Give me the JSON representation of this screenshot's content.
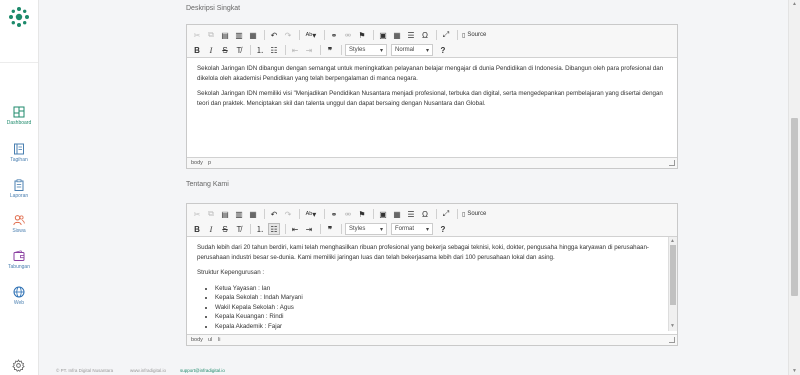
{
  "sidebar": {
    "items": [
      {
        "label": "Dashboard",
        "icon": "dashboard-icon"
      },
      {
        "label": "Tagihan",
        "icon": "book-icon"
      },
      {
        "label": "Laporan",
        "icon": "clipboard-icon"
      },
      {
        "label": "Siswa",
        "icon": "users-icon"
      },
      {
        "label": "Tabungan",
        "icon": "wallet-icon"
      },
      {
        "label": "Web",
        "icon": "globe-icon"
      }
    ],
    "accent": "#1d8a6b"
  },
  "section1": {
    "label": "Deskripsi Singkat",
    "toolbar": {
      "source_label": "Source",
      "styles_label": "Styles",
      "format_label": "Normal"
    },
    "paragraphs": [
      "Sekolah Jaringan IDN dibangun dengan semangat untuk meningkatkan pelayanan belajar mengajar di dunia Pendidikan di Indonesia. Dibangun oleh para profesional dan dikelola oleh akademisi Pendidikan yang telah berpengalaman di manca negara.",
      "Sekolah Jaringan IDN memiliki visi \"Menjadikan Pendidikan Nusantara menjadi profesional, terbuka dan digital, serta mengedepankan pembelajaran yang disertai dengan teori dan praktek. Menciptakan skil dan talenta unggul dan dapat bersaing dengan Nusantara dan Global."
    ],
    "path": [
      "body",
      "p"
    ]
  },
  "section2": {
    "label": "Tentang Kami",
    "toolbar": {
      "source_label": "Source",
      "styles_label": "Styles",
      "format_label": "Format"
    },
    "paragraphs": [
      "Sudah lebih dari 20 tahun berdiri, kami telah menghasilkan ribuan profesional yang bekerja sebagai teknisi, koki, dokter, pengusaha hingga karyawan di perusahaan-perusahaan industri besar se-dunia. Kami memiliki jaringan luas dan telah bekerjasama lebih dari 100 perusahaan lokal dan asing.",
      "Struktur Kepengurusan :"
    ],
    "list": [
      "Ketua Yayasan : Ian",
      "Kepala Sekolah : Indah Maryani",
      "Wakil Kepala Sekolah : Agus",
      "Kepala Keuangan : Rindi",
      "Kepala Akademik : Fajar"
    ],
    "path": [
      "body",
      "ul",
      "li"
    ]
  },
  "footer": {
    "copyright": "© PT. Infra Digital Nusantara",
    "website": "www.infradigital.io",
    "email": "support@infradigital.io"
  }
}
